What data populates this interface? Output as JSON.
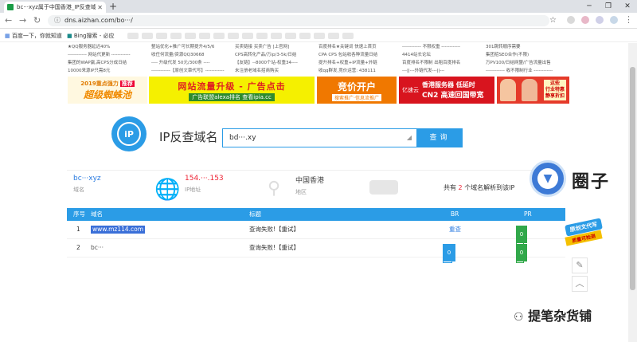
{
  "browser": {
    "tab_title": "bc···xyz属于中国香港_IP反查域",
    "url": "dns.aizhan.com/bo···/",
    "bookmarks": [
      "百度一下，你就知道",
      "Bing搜索 - 必应"
    ]
  },
  "ad_text": {
    "col1": [
      "★QQ服务器延迟40%",
      "------------ 网站代更新 ------------",
      "集团的WAP赢,高CPS分成日结",
      "10000来源IP只需8元"
    ],
    "col2": [
      "整站优化+推广可长期提升4/5/6",
      "收任何流量/资源QQ30668",
      "---- 升级代发 50元/300条 ----",
      "------------【原创文章代写】------------"
    ],
    "col3": [
      "买卖链接 买卖广告 [上官网]",
      "CPS高转化产品/万ip/3-5k/日结",
      "【友链】--8000个站-权重34----",
      "未注册老域名招商购买"
    ],
    "col4": [
      "百度排名★关键词 快速上首页",
      "CPA CPS 包站收各种流量日结",
      "提升排名+权重+IP流量+外链",
      "收qq群发,竞价运营: 438111"
    ],
    "col5": [
      "------------ 不限权重 ------------",
      "4414站长论坛",
      "百度排名不限制 出租百度排名",
      "---||---外链代发---||---"
    ],
    "col6": [
      "301跳转顺序需要",
      "集团招SEO合作(不限)",
      "万PV100/日结网盟/广告流量出售",
      "------------ 收不限制行业 ------------"
    ]
  },
  "banners": {
    "b1_line1": "2019重点强力",
    "b1_tag": "推荐",
    "b1_line2": "超级蜘蛛池",
    "b2_line1": "网站流量升级 - 广告点击",
    "b2_line2": "广告联盟alexa排名 查看ipia.cc",
    "b3_line1": "竞价开户",
    "b3_line2": "搜索推广·信息流推广",
    "b4_brand": "亿速云",
    "b4_line1": "香港服务器 低延时",
    "b4_line2": "CN2 高速回国带宽",
    "b5_line1": "这些",
    "b5_line2": "行业特惠",
    "b5_line3": "静享折扣"
  },
  "search": {
    "logo_text": "iP",
    "title": "IP反查域名",
    "input_value": "bd···.xy",
    "button_label": "查询"
  },
  "info": {
    "domain_value": "bc···xyz",
    "domain_label": "域名",
    "ip_value": "154.···.153",
    "ip_label": "IP地址",
    "region_value": "中国香港",
    "region_label": "地区",
    "count_prefix": "共有",
    "count": "2",
    "count_suffix": "个域名解析到该IP"
  },
  "table": {
    "headers": {
      "num": "序号",
      "domain": "域名",
      "title": "标题",
      "br": "BR",
      "pr": "PR"
    },
    "rows": [
      {
        "num": "1",
        "domain": "www.mz114.com",
        "title": "查询失败!【重试】",
        "br": "重查",
        "pr": "0"
      },
      {
        "num": "2",
        "domain": "bc···",
        "title": "查询失败!【重试】",
        "br": "0",
        "pr": "0"
      }
    ]
  },
  "watermark": {
    "text": "圈子",
    "badge_line1": "原创文代写",
    "badge_line2": "质量可检测",
    "wechat": "提笔杂货铺"
  }
}
